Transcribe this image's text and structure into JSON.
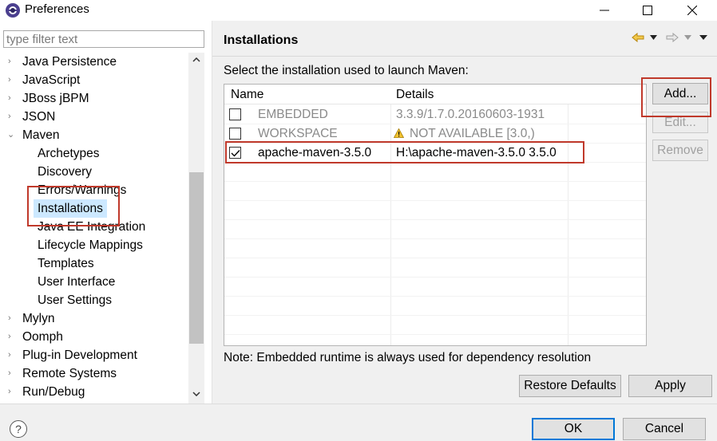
{
  "window": {
    "title": "Preferences",
    "controls": [
      "minimize",
      "maximize",
      "close"
    ]
  },
  "sidebar": {
    "filter_placeholder": "type filter text",
    "tree": [
      {
        "label": "Java Persistence",
        "level": 0,
        "expanded": false
      },
      {
        "label": "JavaScript",
        "level": 0,
        "expanded": false
      },
      {
        "label": "JBoss jBPM",
        "level": 0,
        "expanded": false
      },
      {
        "label": "JSON",
        "level": 0,
        "expanded": false
      },
      {
        "label": "Maven",
        "level": 0,
        "expanded": true
      },
      {
        "label": "Archetypes",
        "level": 1
      },
      {
        "label": "Discovery",
        "level": 1
      },
      {
        "label": "Errors/Warnings",
        "level": 1
      },
      {
        "label": "Installations",
        "level": 1,
        "selected": true
      },
      {
        "label": "Java EE Integration",
        "level": 1
      },
      {
        "label": "Lifecycle Mappings",
        "level": 1
      },
      {
        "label": "Templates",
        "level": 1
      },
      {
        "label": "User Interface",
        "level": 1
      },
      {
        "label": "User Settings",
        "level": 1
      },
      {
        "label": "Mylyn",
        "level": 0,
        "expanded": false
      },
      {
        "label": "Oomph",
        "level": 0,
        "expanded": false
      },
      {
        "label": "Plug-in Development",
        "level": 0,
        "expanded": false
      },
      {
        "label": "Remote Systems",
        "level": 0,
        "expanded": false
      },
      {
        "label": "Run/Debug",
        "level": 0,
        "expanded": false
      }
    ]
  },
  "main": {
    "title": "Installations",
    "instruction": "Select the installation used to launch Maven:",
    "table": {
      "columns": [
        "Name",
        "Details"
      ],
      "rows": [
        {
          "checked": false,
          "name": "EMBEDDED",
          "details": "3.3.9/1.7.0.20160603-1931",
          "muted": true,
          "warning": false
        },
        {
          "checked": false,
          "name": "WORKSPACE",
          "details": "NOT AVAILABLE [3.0,)",
          "muted": true,
          "warning": true
        },
        {
          "checked": true,
          "name": "apache-maven-3.5.0",
          "details": "H:\\apache-maven-3.5.0 3.5.0",
          "muted": false,
          "warning": false
        }
      ]
    },
    "buttons": {
      "add": "Add...",
      "edit": "Edit...",
      "remove": "Remove",
      "restore_defaults": "Restore Defaults",
      "apply": "Apply"
    },
    "note": "Note: Embedded runtime is always used for dependency resolution"
  },
  "footer": {
    "help": "?",
    "ok": "OK",
    "cancel": "Cancel"
  },
  "colors": {
    "selection": "#cce8ff",
    "annotation_red": "#c0392b",
    "warning": "#e6a700"
  }
}
